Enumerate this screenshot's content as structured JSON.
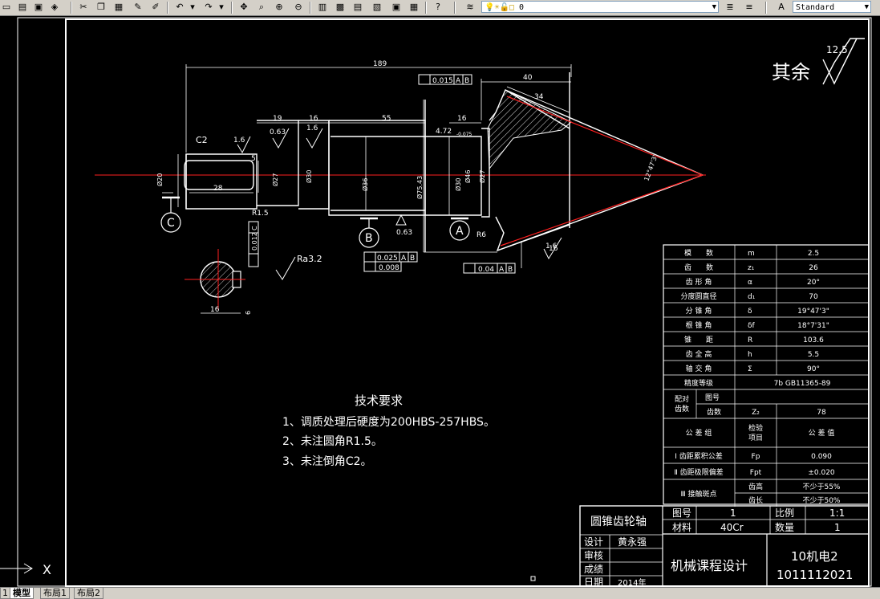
{
  "toolbar": {
    "layer_value": "0",
    "text_style": "Standard"
  },
  "tabs": [
    {
      "label": "模型"
    },
    {
      "label": "布局1"
    },
    {
      "label": "布局2"
    }
  ],
  "drawing": {
    "dims": {
      "d189": "189",
      "d40": "40",
      "d34": "34",
      "d19": "19",
      "d16a": "16",
      "d55": "55",
      "d16b": "16",
      "d28": "28",
      "d5": "5",
      "c2": "C2",
      "r15": "R1.5",
      "r6": "R6",
      "d16c": "16",
      "d472": "4.72",
      "d075": "-0.075",
      "ang": "12°47'3\"",
      "dia20": "Ø20",
      "dia27a": "Ø27",
      "dia30a": "Ø30",
      "dia36": "Ø36",
      "dia7543": "Ø75.43",
      "dia30b": "Ø30",
      "dia46": "Ø46",
      "dia27b": "Ø27"
    },
    "roughness": {
      "r16a": "1.6",
      "r063a": "0.63",
      "r16b": "1.6",
      "r063b": "0.63",
      "r16c": "1.6",
      "ra32": "Ra3.2",
      "qy_label": "其余",
      "qy_value": "12.5"
    },
    "tolerances": {
      "t1_val": "0.015",
      "t1_a": "A",
      "t1_b": "B",
      "t2_val": "0.025",
      "t2_a": "A",
      "t2_b": "B",
      "t2_val2": "0.008",
      "t3_val": "0.04",
      "t3_a": "A",
      "t3_b": "B",
      "t4_val": "0.012",
      "t4_ref": "C"
    },
    "datums": {
      "a": "A",
      "b": "B",
      "c": "C"
    },
    "section": {
      "w16": "16",
      "k6": "6"
    }
  },
  "tech_req": {
    "title": "技术要求",
    "items": [
      "1、调质处理后硬度为200HBS-257HBS。",
      "2、未注圆角R1.5。",
      "3、未注倒角C2。"
    ]
  },
  "param_table": [
    {
      "name": "模　　数",
      "sym": "m",
      "val": "2.5"
    },
    {
      "name": "齿　　数",
      "sym": "z₁",
      "val": "26"
    },
    {
      "name": "齿 形 角",
      "sym": "α",
      "val": "20°"
    },
    {
      "name": "分度圆直径",
      "sym": "d₁",
      "val": "70"
    },
    {
      "name": "分 锥 角",
      "sym": "δ",
      "val": "19°47'3\""
    },
    {
      "name": "根 锥 角",
      "sym": "δf",
      "val": "18°7'31\""
    },
    {
      "name": "锥　　距",
      "sym": "R",
      "val": "103.6"
    },
    {
      "name": "齿 全 高",
      "sym": "h",
      "val": "5.5"
    },
    {
      "name": "轴 交 角",
      "sym": "Σ",
      "val": "90°"
    }
  ],
  "precision": {
    "label": "精度等级",
    "value": "7b GB11365-89"
  },
  "mating": {
    "label1": "配对",
    "label2": "齿数",
    "fig_label": "图号",
    "teeth_label": "齿数",
    "teeth_sym": "Z₂",
    "teeth_val": "78"
  },
  "tol_header": {
    "group": "公 差 组",
    "item1": "检验",
    "item2": "项目",
    "value": "公 差 值"
  },
  "tol_rows": [
    {
      "name": "Ⅰ 齿距累积公差",
      "sym": "Fp",
      "val": "0.090"
    },
    {
      "name": "Ⅱ 齿距极限偏差",
      "sym": "Fpt",
      "val": "±0.020"
    }
  ],
  "contact": {
    "name": "Ⅲ 接触斑点",
    "r1_label": "齿高",
    "r1_val": "不少于55%",
    "r2_label": "齿长",
    "r2_val": "不少于50%"
  },
  "title_block": {
    "part_name": "圆锥齿轮轴",
    "fig_no_label": "图号",
    "fig_no": "1",
    "scale_label": "比例",
    "scale": "1:1",
    "material_label": "材料",
    "material": "40Cr",
    "qty_label": "数量",
    "qty": "1",
    "design_label": "设计",
    "designer": "黄永强",
    "review_label": "审核",
    "grade_label": "成绩",
    "date_label": "日期",
    "date": "2014年",
    "course": "机械课程设计",
    "class_name": "10机电2",
    "student_id": "1011112021"
  },
  "ucs": {
    "x_label": "X"
  }
}
